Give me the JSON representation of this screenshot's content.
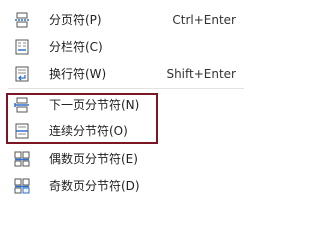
{
  "menu": {
    "items": [
      {
        "label": "分页符(P)",
        "shortcut": "Ctrl+Enter",
        "icon": "page-break-icon"
      },
      {
        "label": "分栏符(C)",
        "shortcut": "",
        "icon": "column-break-icon"
      },
      {
        "label": "换行符(W)",
        "shortcut": "Shift+Enter",
        "icon": "line-break-icon"
      },
      {
        "label": "下一页分节符(N)",
        "shortcut": "",
        "icon": "next-page-section-break-icon"
      },
      {
        "label": "连续分节符(O)",
        "shortcut": "",
        "icon": "continuous-section-break-icon"
      },
      {
        "label": "偶数页分节符(E)",
        "shortcut": "",
        "icon": "even-page-section-break-icon"
      },
      {
        "label": "奇数页分节符(D)",
        "shortcut": "",
        "icon": "odd-page-section-break-icon"
      }
    ]
  },
  "colors": {
    "icon_blue": "#2f6fcf",
    "highlight_border": "#7b1624",
    "text": "#222222"
  }
}
